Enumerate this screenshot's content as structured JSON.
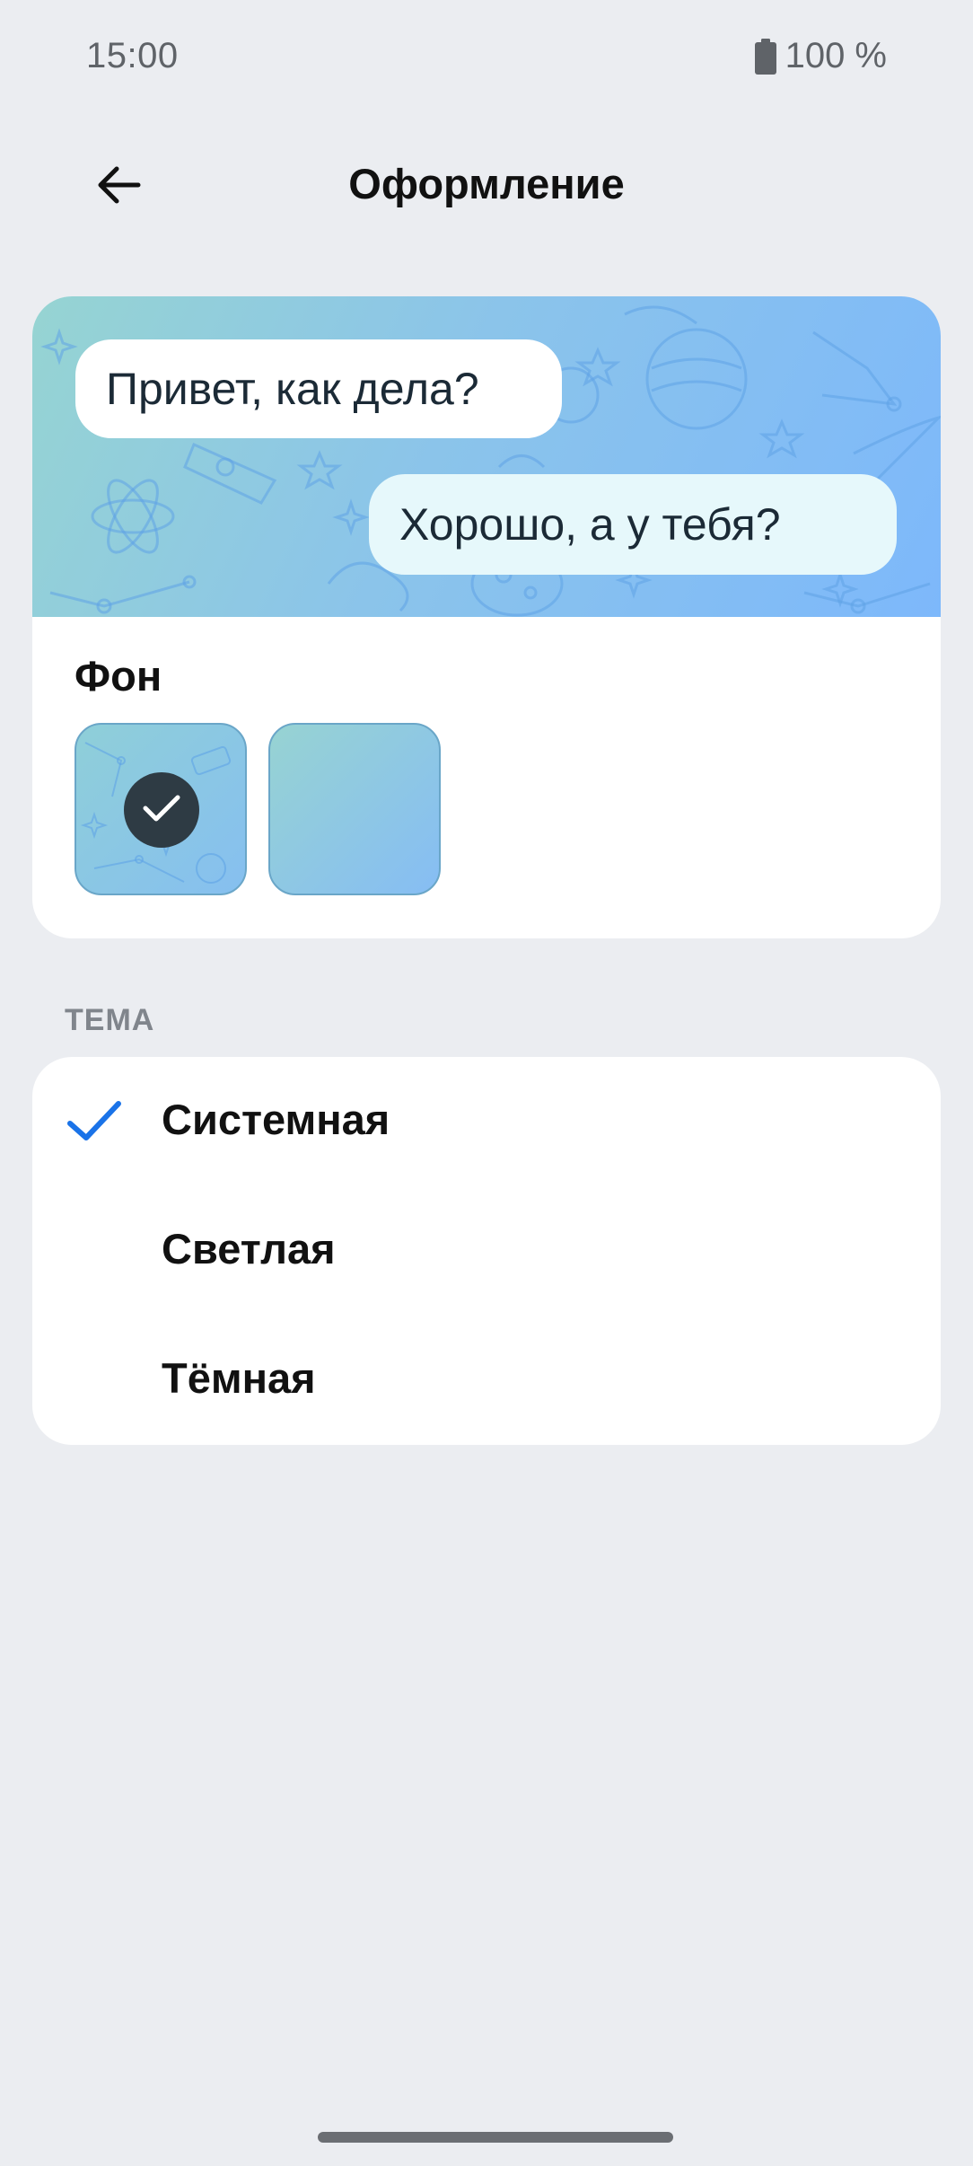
{
  "status_bar": {
    "time": "15:00",
    "battery": "100 %"
  },
  "top_bar": {
    "title": "Оформление",
    "back_icon": "arrow-left-icon"
  },
  "preview": {
    "incoming_message": "Привет, как дела?",
    "outgoing_message": "Хорошо, а у тебя?"
  },
  "background_section": {
    "label": "Фон",
    "options": [
      {
        "name": "space-pattern",
        "selected": true
      },
      {
        "name": "gradient",
        "selected": false
      }
    ]
  },
  "theme_section": {
    "header": "ТЕМА",
    "options": [
      {
        "label": "Системная",
        "selected": true
      },
      {
        "label": "Светлая",
        "selected": false
      },
      {
        "label": "Тёмная",
        "selected": false
      }
    ]
  },
  "colors": {
    "accent": "#1a73e8",
    "background": "#ebedf1",
    "card": "#ffffff"
  }
}
